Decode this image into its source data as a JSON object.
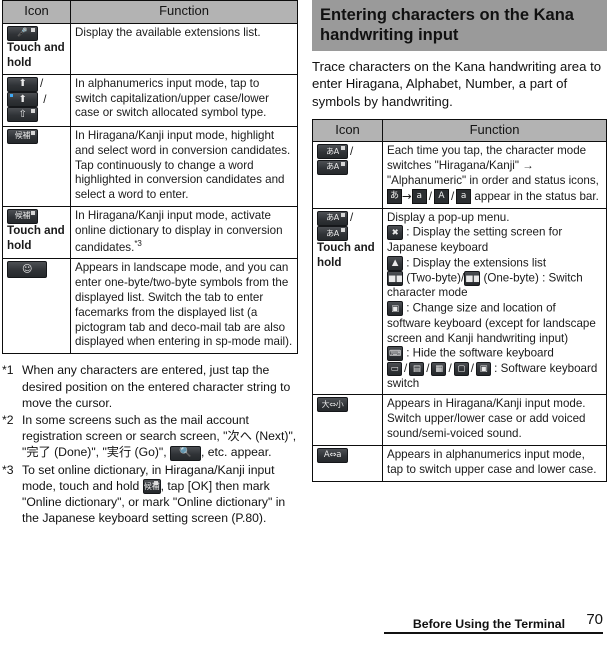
{
  "left_table": {
    "headers": [
      "Icon",
      "Function"
    ],
    "rows": [
      {
        "icon_name": "microphone-key-icon",
        "icon_sub": "Touch and hold",
        "function": "Display the available extensions list."
      },
      {
        "icon_name": "shift-caps-key-icons",
        "icon_sub": "",
        "function": "In alphanumerics input mode, tap to switch capitalization/upper case/lower case or switch allocated symbol type."
      },
      {
        "icon_name": "conversion-candidate-key-icon",
        "icon_sub": "",
        "function": "In Hiragana/Kanji input mode, highlight and select word in conversion candidates. Tap continuously to change a word highlighted in conversion candidates and select a word to enter."
      },
      {
        "icon_name": "conversion-candidate-key-icon",
        "icon_sub": "Touch and hold",
        "function": "In Hiragana/Kanji input mode, activate online dictionary to display in conversion candidates.",
        "function_footnote": "*3"
      },
      {
        "icon_name": "smiley-symbol-key-icon",
        "icon_sub": "",
        "function": "Appears in landscape mode, and you can enter one-byte/two-byte symbols from the displayed list. Switch the tab to enter facemarks from the displayed list (a pictogram tab and deco-mail tab are also displayed when entering in sp-mode mail)."
      }
    ]
  },
  "footnotes": [
    {
      "marker": "*1",
      "text": "When any characters are entered, just tap the desired position on the entered character string to move the cursor."
    },
    {
      "marker": "*2",
      "text_part1": "In some screens such as the mail account registration screen or search screen, \"次へ (Next)\", \"完了 (Done)\", \"実行 (Go)\", ",
      "inline_icon": "search-key-icon",
      "text_part2": ", etc. appear."
    },
    {
      "marker": "*3",
      "text_part1": "To set online dictionary, in Hiragana/Kanji input mode, touch and hold ",
      "inline_icon": "conversion-candidate-key-icon",
      "text_part2": ", tap [OK] then mark \"Online dictionary\", or mark \"Online dictionary\" in the Japanese keyboard setting screen (P.80)."
    }
  ],
  "section": {
    "heading": "Entering characters on the Kana handwriting input",
    "intro": "Trace characters on the Kana handwriting area to enter Hiragana, Alphabet, Number, a part of symbols by handwriting."
  },
  "right_table": {
    "headers": [
      "Icon",
      "Function"
    ],
    "rows": [
      {
        "icon_name": "char-mode-switch-key-icons",
        "icon_sub": "",
        "function_lines": [
          "Each time you tap, the character mode switches \"Hiragana/Kanji\" → \"Alphanumeric\" in order and status icons,",
          "appear in the status bar."
        ],
        "status_icons": [
          "あ",
          "a",
          "A",
          "a"
        ]
      },
      {
        "icon_name": "char-mode-switch-key-icons",
        "icon_sub": "Touch and hold",
        "function_intro": "Display a pop-up menu.",
        "bullets": [
          {
            "icon": "settings-key-icon",
            "text": ": Display the setting screen for Japanese keyboard"
          },
          {
            "icon": "extensions-key-icon",
            "text": ": Display the extensions list"
          },
          {
            "icon": "two-byte-key-icon",
            "text": "(Two-byte)/",
            "icon2": "one-byte-key-icon",
            "text2": "(One-byte) : Switch character mode"
          },
          {
            "icon": "resize-key-icon",
            "text": ": Change size and location of software keyboard (except for landscape screen and Kanji handwriting input)"
          },
          {
            "icon": "hide-keyboard-key-icon",
            "text": ": Hide the software keyboard"
          },
          {
            "icon": "kb-switch-icons",
            "text": ": Software keyboard switch"
          }
        ]
      },
      {
        "icon_name": "large-small-key-icon",
        "icon_label": "大⇔小",
        "icon_sub": "",
        "function": "Appears in Hiragana/Kanji input mode. Switch upper/lower case or add voiced sound/semi-voiced sound."
      },
      {
        "icon_name": "upper-lower-key-icon",
        "icon_label": "A⇔a",
        "icon_sub": "",
        "function": "Appears in alphanumerics input mode, tap to switch upper case and lower case."
      }
    ]
  },
  "footer": {
    "title": "Before Using the Terminal",
    "page_number": "70"
  },
  "colors": {
    "header_bg": "#b3b3b3",
    "section_bg": "#9a9a9a",
    "border": "#0d0d0d",
    "text": "#111111",
    "key_bg": "#303337",
    "accent_blue": "#3fa9f5"
  }
}
